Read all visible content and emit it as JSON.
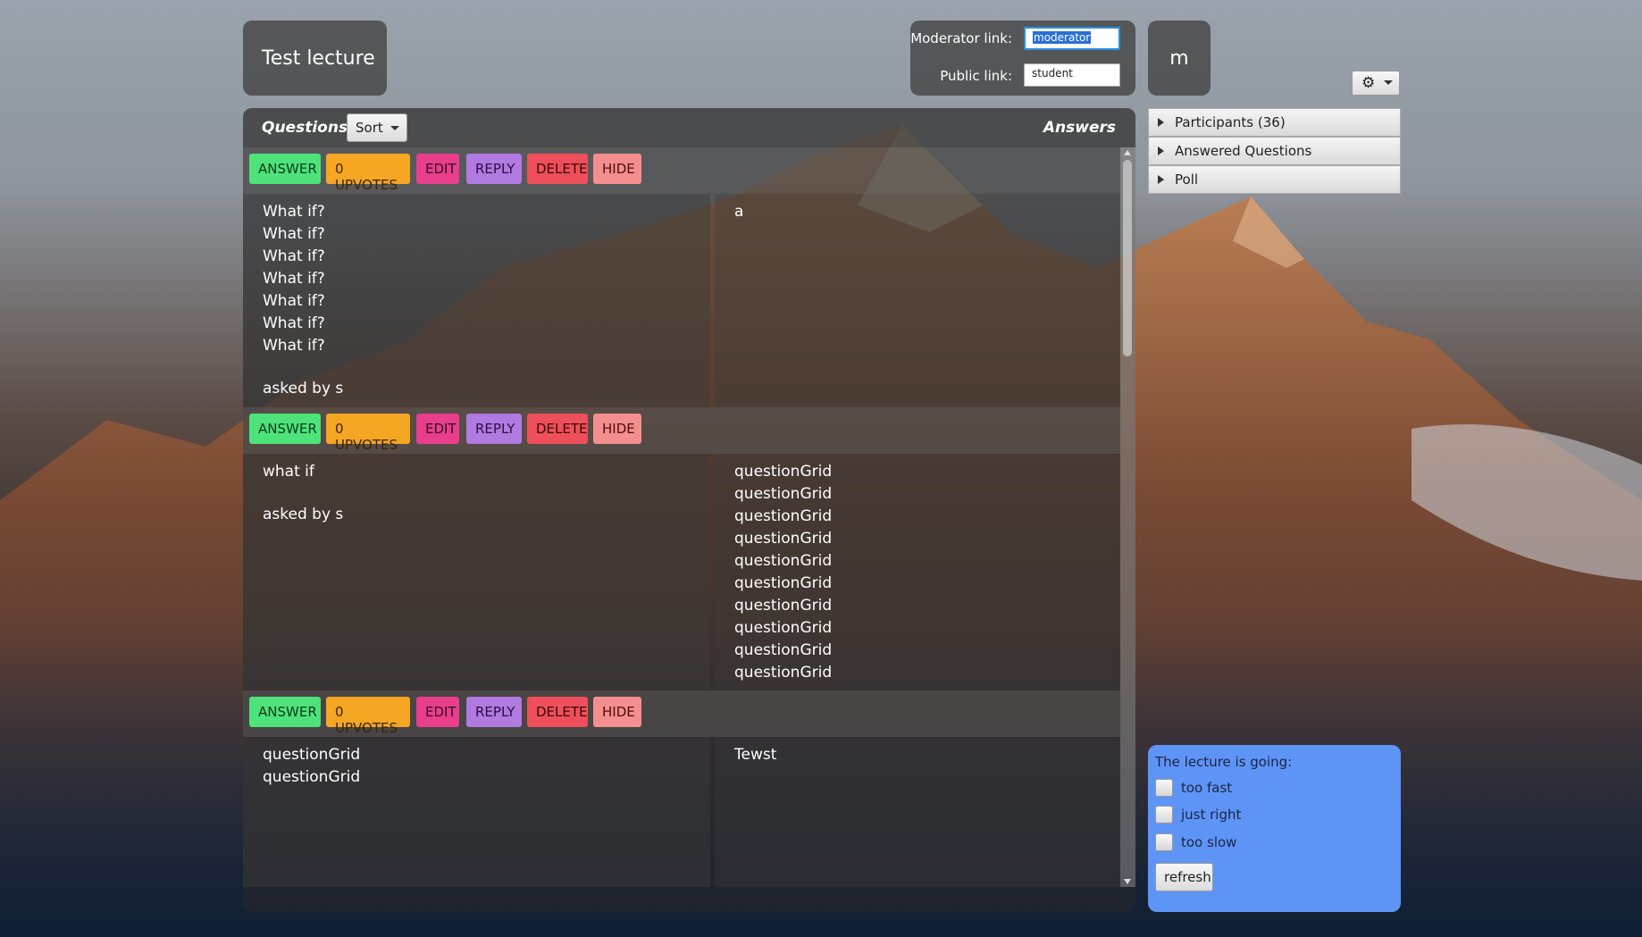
{
  "header": {
    "lecture_title": "Test lecture",
    "moderator_label": "Moderator link:",
    "moderator_value": "moderator",
    "public_label": "Public link:",
    "public_value": "student",
    "user_initial": "m",
    "settings_icon": "gear-icon"
  },
  "main": {
    "questions_heading": "Questions",
    "sort_label": "Sort",
    "answers_heading": "Answers",
    "buttons": {
      "answer": "ANSWER",
      "upvotes": "0 UPVOTES",
      "edit": "EDIT",
      "reply": "REPLY",
      "delete": "DELETE",
      "hide": "HIDE"
    },
    "questions": [
      {
        "lines": [
          "What if?",
          "What if?",
          "What if?",
          "What if?",
          "What if?",
          "What if?",
          "What if?"
        ],
        "asked_by": "asked by s",
        "answers": [
          "a"
        ]
      },
      {
        "lines": [
          "what if"
        ],
        "asked_by": "asked by s",
        "answers": [
          "questionGrid",
          "questionGrid",
          "questionGrid",
          "questionGrid",
          "questionGrid",
          "questionGrid",
          "questionGrid",
          "questionGrid",
          "questionGrid",
          "questionGrid"
        ]
      },
      {
        "lines": [
          "questionGrid",
          "questionGrid"
        ],
        "asked_by": "",
        "answers": [
          "Tewst"
        ]
      }
    ]
  },
  "sidebar": {
    "items": [
      {
        "label": "Participants (36)"
      },
      {
        "label": "Answered Questions"
      },
      {
        "label": "Poll"
      }
    ]
  },
  "feedback": {
    "title": "The lecture is going:",
    "options": [
      "too fast",
      "just right",
      "too slow"
    ],
    "refresh_label": "refresh"
  }
}
